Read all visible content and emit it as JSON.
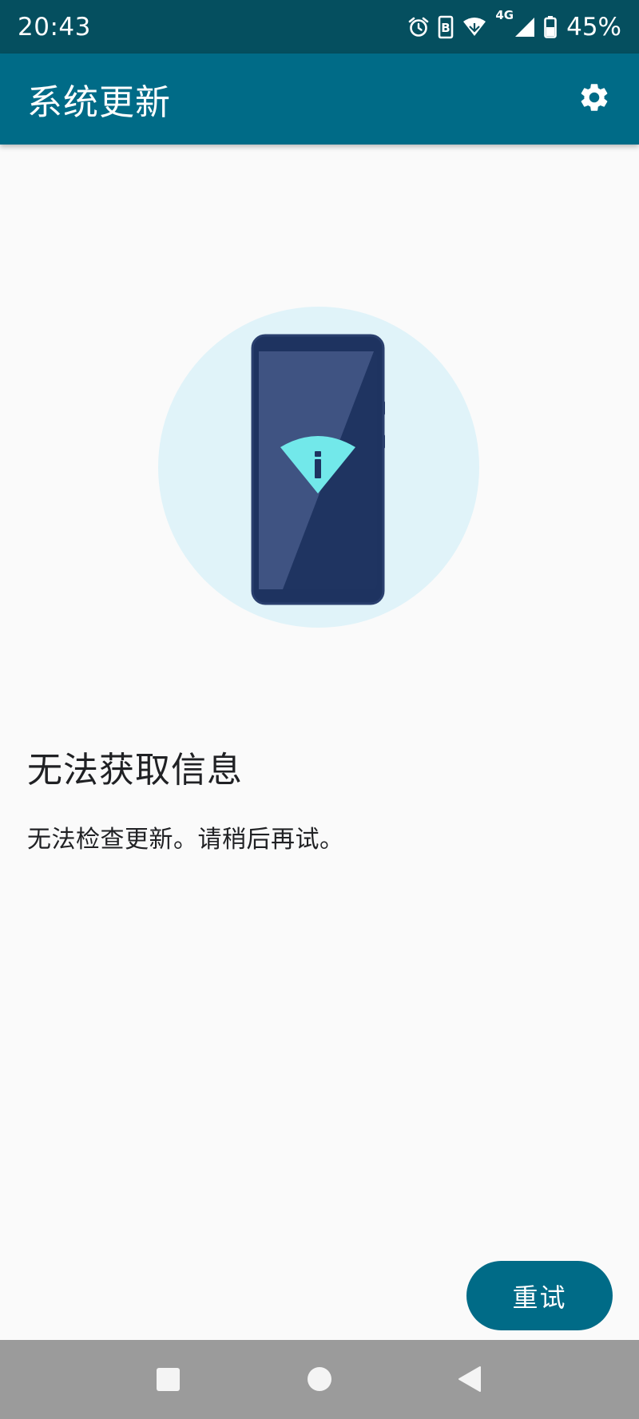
{
  "status_bar": {
    "time": "20:43",
    "signal_type": "4G",
    "battery_percent": "45%",
    "icons": [
      "alarm-icon",
      "data-saver-icon",
      "wifi-icon",
      "cellular-signal-icon",
      "battery-icon"
    ]
  },
  "app_bar": {
    "title": "系统更新",
    "settings_icon": "gear-icon"
  },
  "main": {
    "heading": "无法获取信息",
    "message": "无法检查更新。请稍后再试。",
    "retry_label": "重试"
  },
  "nav_bar": {
    "buttons": [
      "recents-icon",
      "home-icon",
      "back-icon"
    ]
  },
  "colors": {
    "status_bar": "#054f5f",
    "app_bar": "#006b87",
    "accent": "#006b87",
    "illustration_circle": "#e0f3f9",
    "phone_body": "#1e3360",
    "info_badge": "#72e8ea"
  }
}
